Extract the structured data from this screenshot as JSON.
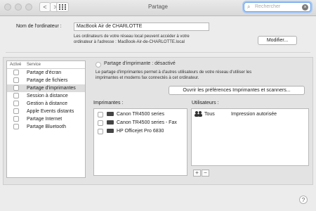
{
  "window": {
    "title": "Partage"
  },
  "toolbar": {
    "back_label": "<",
    "forward_label": ">",
    "search_placeholder": "Rechercher"
  },
  "computer": {
    "name_label": "Nom de l'ordinateur :",
    "name_value": "MacBook Air de CHARLOTTE",
    "info_line1": "Les ordinateurs de votre réseau local peuvent accéder à votre",
    "info_line2": "ordinateur à l'adresse : MacBook-Air-de-CHARLOTTE.local",
    "modify_label": "Modifier..."
  },
  "services": {
    "header_active": "Activé",
    "header_service": "Service",
    "items": [
      {
        "label": "Partage d'écran",
        "enabled": false
      },
      {
        "label": "Partage de fichiers",
        "enabled": false
      },
      {
        "label": "Partage d'imprimantes",
        "enabled": false
      },
      {
        "label": "Session à distance",
        "enabled": false
      },
      {
        "label": "Gestion à distance",
        "enabled": false
      },
      {
        "label": "Apple Events distants",
        "enabled": false
      },
      {
        "label": "Partage Internet",
        "enabled": false
      },
      {
        "label": "Partage Bluetooth",
        "enabled": false
      }
    ],
    "selected_index": 2
  },
  "printer_sharing": {
    "status": "Partage d'imprimante : désactivé",
    "desc_line1": "Le partage d'imprimantes permet à d'autres utilisateurs de votre réseau d'utiliser les",
    "desc_line2": "imprimantes et modems fax connectés à cet ordinateur.",
    "open_prefs_label": "Ouvrir les préférences Imprimantes et scanners...",
    "printers_label": "Imprimantes :",
    "users_label": "Utilisateurs :",
    "printers": [
      {
        "name": "Canon TR4500 series",
        "checked": false
      },
      {
        "name": "Canon TR4500 series - Fax",
        "checked": false
      },
      {
        "name": "HP Officejet Pro 6830",
        "checked": false
      }
    ],
    "users": [
      {
        "name": "Tous",
        "permission": "Impression autorisée",
        "icon": "users-icon"
      }
    ],
    "add_label": "+",
    "remove_label": "−"
  },
  "help": {
    "label": "?"
  }
}
